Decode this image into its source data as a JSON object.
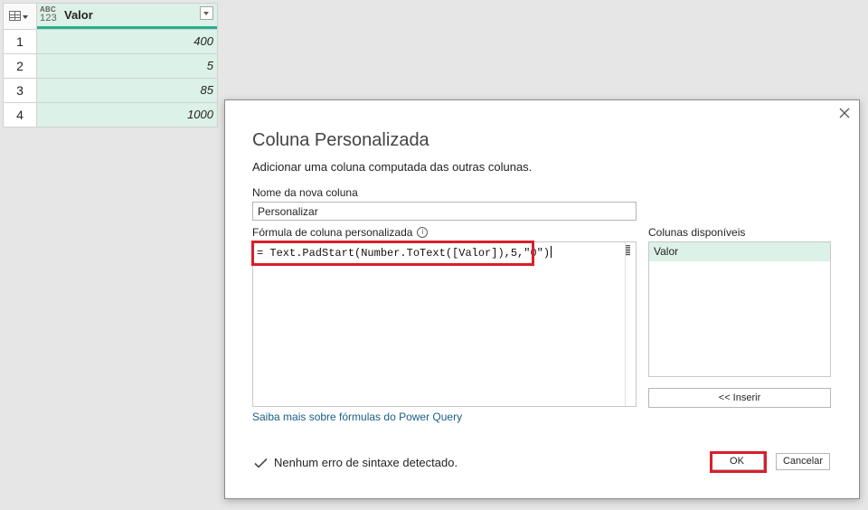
{
  "grid": {
    "column": {
      "type_icon_top": "ABC",
      "type_icon_bottom": "123",
      "name": "Valor"
    },
    "rows": [
      {
        "index": "1",
        "value": "400"
      },
      {
        "index": "2",
        "value": "5"
      },
      {
        "index": "3",
        "value": "85"
      },
      {
        "index": "4",
        "value": "1000"
      }
    ]
  },
  "dialog": {
    "title": "Coluna Personalizada",
    "description": "Adicionar uma coluna computada das outras colunas.",
    "name_label": "Nome da nova coluna",
    "name_value": "Personalizar",
    "formula_label": "Fórmula de coluna personalizada",
    "formula_info_icon": "i",
    "formula": "= Text.PadStart(Number.ToText([Valor]),5,\"0\")",
    "available_label": "Colunas disponíveis",
    "available_columns": [
      "Valor"
    ],
    "insert_label": "<< Inserir",
    "learn_more": "Saiba mais sobre fórmulas do Power Query",
    "status": "Nenhum erro de sintaxe detectado.",
    "ok_label": "OK",
    "cancel_label": "Cancelar"
  },
  "icons": {
    "corner": "table-icon",
    "type": "any-type-icon",
    "filter": "dropdown-icon",
    "close": "close-icon",
    "info": "info-icon",
    "status": "check-icon"
  },
  "colors": {
    "selected_column": "#dcf1e8",
    "column_accent": "#23b28b",
    "highlight": "#d7202b",
    "link": "#1b5e85",
    "check": "#4a4a4a"
  }
}
